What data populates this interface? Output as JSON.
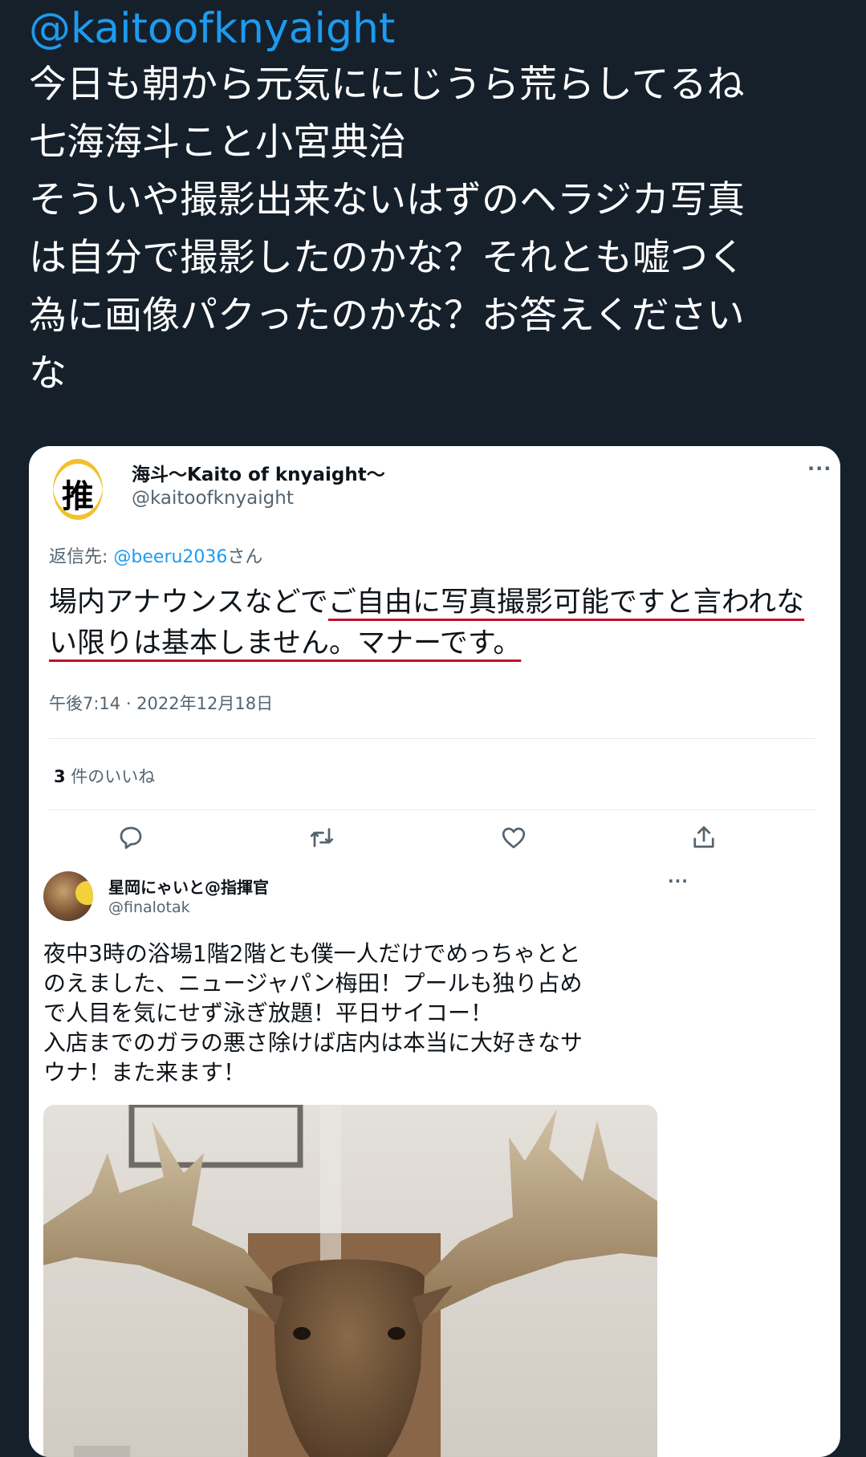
{
  "post": {
    "handle": "@kaitoofknyaight",
    "text": "今日も朝から元気ににじうら荒らしてるね\n七海海斗こと小宮典治\nそういや撮影出来ないはずのヘラジカ写真\nは自分で撮影したのかな？それとも嘘つく\n為に画像パクったのかな？お答えください\nな"
  },
  "quoted": {
    "avatar_char": "推",
    "name": "海斗〜Kaito of knyaight〜",
    "username": "@kaitoofknyaight",
    "more": "···",
    "reply_prefix": "返信先: ",
    "reply_mention": "@beeru2036",
    "reply_suffix": "さん",
    "body_plain": "場内アナウンスなどで",
    "body_underlined": "ご自由に写真撮影可能ですと言われない限りは基本しません。マナーです。",
    "timestamp": "午後7:14 · 2022年12月18日",
    "likes_count": "3",
    "likes_label": " 件のいいね"
  },
  "inner": {
    "name": "星岡にゃいと@指揮官",
    "username": "@finalotak",
    "more": "···",
    "text": "夜中3時の浴場1階2階とも僕一人だけでめっちゃとと\nのえました、ニュージャパン梅田！プールも独り占め\nで人目を気にせず泳ぎ放題！平日サイコー！\n入店までのガラの悪さ除けば店内は本当に大好きなサ\nウナ！また来ます！"
  },
  "colors": {
    "background": "#15202b",
    "accent": "#1d9bf0",
    "underline": "#c2102a"
  }
}
